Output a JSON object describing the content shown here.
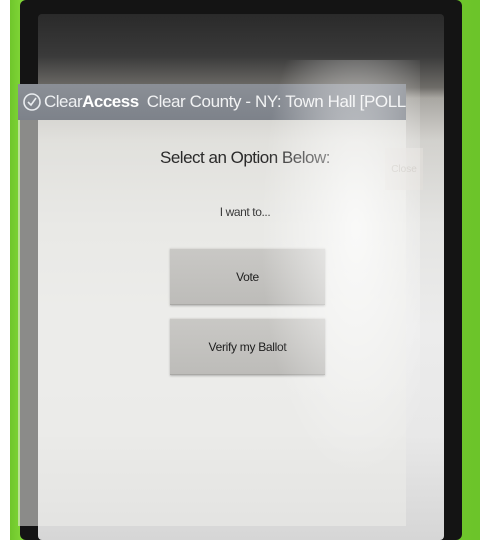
{
  "header": {
    "logo_light": "Clear",
    "logo_bold": "Access",
    "location": "Clear County - NY: Town Hall [POLLS_OPEN]"
  },
  "main": {
    "heading": "Select an Option Below:",
    "prompt": "I want to...",
    "close_label": "Close",
    "options": [
      {
        "label": "Vote"
      },
      {
        "label": "Verify my Ballot"
      }
    ]
  },
  "colors": {
    "casing": "#7fd437",
    "header_bar": "#858a91",
    "button": "#c4c3c0"
  },
  "icons": {
    "logo": "clearaccess-logo-icon"
  }
}
